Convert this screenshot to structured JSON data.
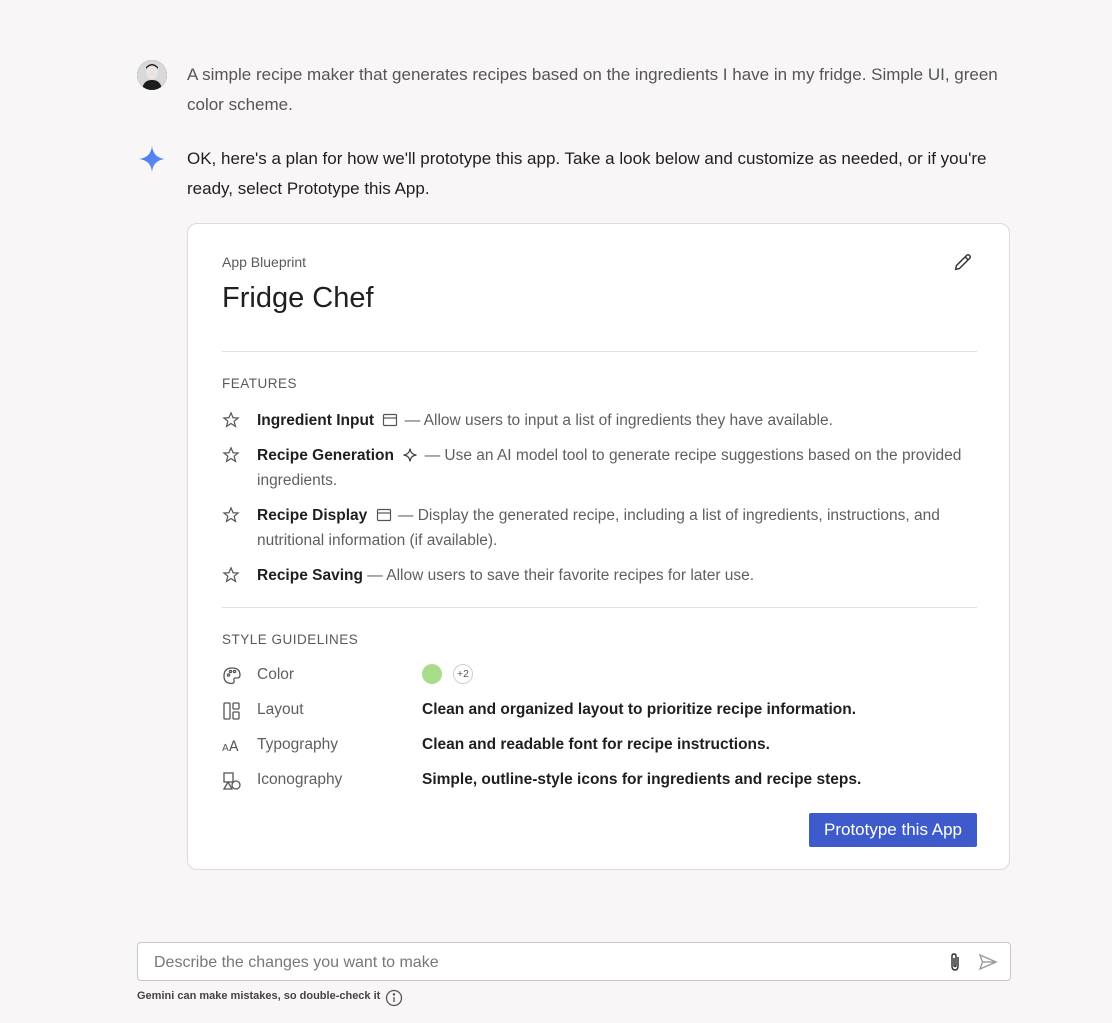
{
  "user_message": {
    "text": "A simple recipe maker that generates recipes based on the ingredients I have in my fridge. Simple UI, green color scheme."
  },
  "ai_message": {
    "text": "OK, here's a plan for how we'll prototype this app. Take a look below and customize as needed, or if you're ready, select Prototype this App."
  },
  "blueprint": {
    "eyebrow": "App Blueprint",
    "title": "Fridge Chef",
    "features_label": "FEATURES",
    "features": [
      {
        "name": "Ingredient Input",
        "icon": "window-icon",
        "desc": " — Allow users to input a list of ingredients they have available."
      },
      {
        "name": "Recipe Generation",
        "icon": "sparkle-icon",
        "desc": " — Use an AI model tool to generate recipe suggestions based on the provided ingredients."
      },
      {
        "name": "Recipe Display",
        "icon": "window-icon",
        "desc": " — Display the generated recipe, including a list of ingredients, instructions, and nutritional information (if available)."
      },
      {
        "name": "Recipe Saving",
        "icon": "",
        "desc": " — Allow users to save their favorite recipes for later use."
      }
    ],
    "style_label": "STYLE GUIDELINES",
    "style": {
      "color": {
        "label": "Color",
        "swatch": "#a8dc8c",
        "more": "+2"
      },
      "layout": {
        "label": "Layout",
        "value": "Clean and organized layout to prioritize recipe information."
      },
      "typography": {
        "label": "Typography",
        "value": "Clean and readable font for recipe instructions."
      },
      "iconography": {
        "label": "Iconography",
        "value": "Simple, outline-style icons for ingredients and recipe steps."
      }
    },
    "prototype_button": "Prototype this App"
  },
  "composer": {
    "placeholder": "Describe the changes you want to make"
  },
  "disclaimer": "Gemini can make mistakes, so double-check it",
  "colors": {
    "accent": "#3f5bcb",
    "spark": "#4a7cf0"
  }
}
